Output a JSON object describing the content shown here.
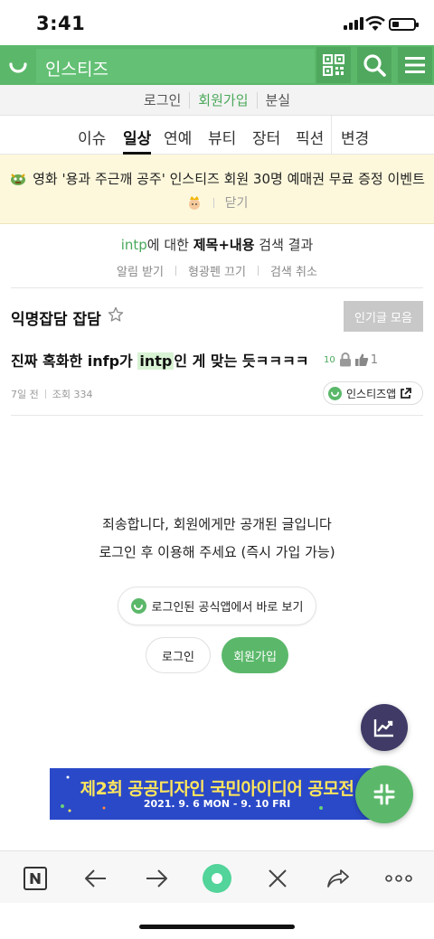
{
  "status_bar": {
    "time": "3:41"
  },
  "header": {
    "site_name": "인스티즈"
  },
  "auth_links": [
    "로그인",
    "회원가입",
    "분실"
  ],
  "categories": [
    "이슈",
    "일상",
    "연예",
    "뷰티",
    "장터",
    "픽션",
    "변경"
  ],
  "active_category": "일상",
  "event": {
    "text": "영화 '용과 주근깨 공주' 인스티즈 회원 30명 예매권 무료 증정 이벤트",
    "close_label": "닫기"
  },
  "search": {
    "keyword": "intp",
    "middle": "에 대한 ",
    "scope": "제목+내용",
    "suffix": " 검색 결과",
    "options": [
      "알림 받기",
      "형광펜 끄기",
      "검색 취소"
    ]
  },
  "board": {
    "name": "익명잡담 잡담",
    "popular_button": "인기글 모음"
  },
  "post": {
    "title_before": "진짜 혹화한 infp가 ",
    "title_highlight": "intp",
    "title_after": "인 게 맞는 듯ㅋㅋㅋㅋ",
    "comment_count": "10",
    "like_count": "1",
    "age": "7일 전",
    "views": "조회 334",
    "app_button": "인스티즈앱"
  },
  "locked": {
    "line1": "죄송합니다, 회원에게만 공개된 글입니다",
    "line2": "로그인 후 이용해 주세요 (즉시 가입 가능)",
    "official_app_button": "로그인된 공식앱에서 바로 보기",
    "login_button": "로그인",
    "join_button": "회원가입"
  },
  "ad": {
    "title": "제2회 공공디자인 국민아이디어 공모전",
    "date": "2021. 9. 6 MON - 9. 10 FRI"
  },
  "colors": {
    "brand_green": "#5bb86a",
    "event_bg": "#fdf8dc",
    "fab_dark": "#3f3b66",
    "ad_blue": "#2a49c8"
  }
}
